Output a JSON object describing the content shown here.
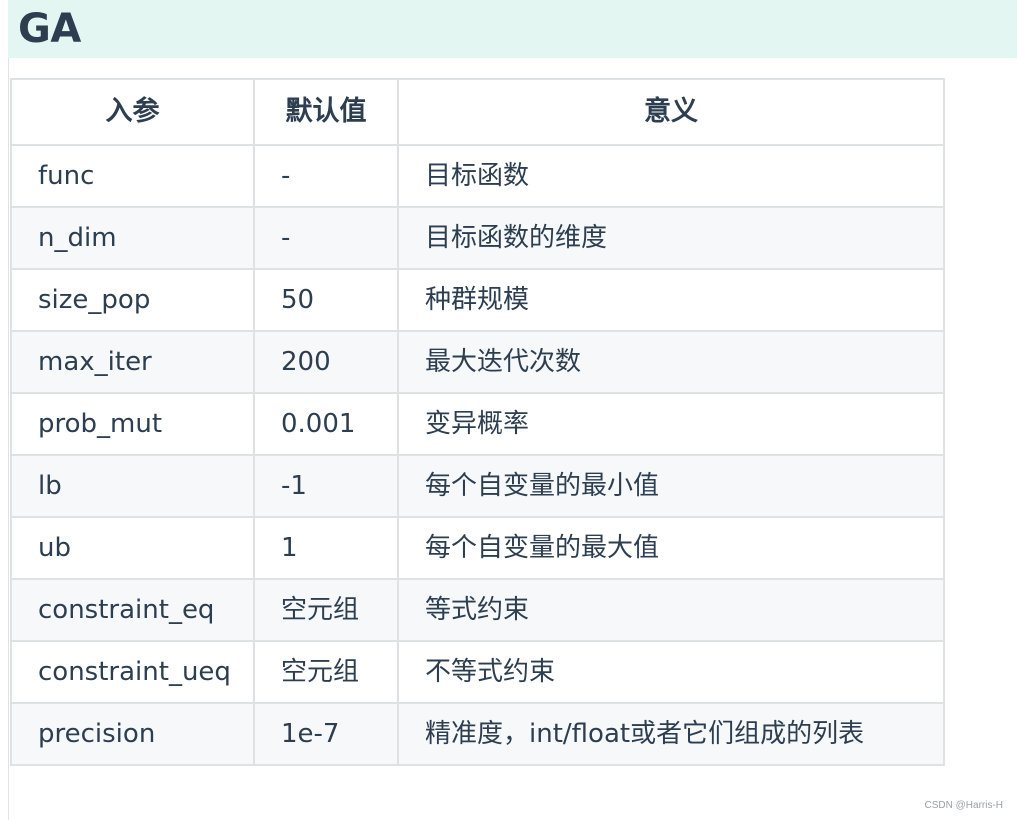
{
  "heading": "GA",
  "table": {
    "headers": [
      "入参",
      "默认值",
      "意义"
    ],
    "rows": [
      [
        "func",
        "-",
        "目标函数"
      ],
      [
        "n_dim",
        "-",
        "目标函数的维度"
      ],
      [
        "size_pop",
        "50",
        "种群规模"
      ],
      [
        "max_iter",
        "200",
        "最大迭代次数"
      ],
      [
        "prob_mut",
        "0.001",
        "变异概率"
      ],
      [
        "lb",
        "-1",
        "每个自变量的最小值"
      ],
      [
        "ub",
        "1",
        "每个自变量的最大值"
      ],
      [
        "constraint_eq",
        "空元组",
        "等式约束"
      ],
      [
        "constraint_ueq",
        "空元组",
        "不等式约束"
      ],
      [
        "precision",
        "1e-7",
        "精准度，int/float或者它们组成的列表"
      ]
    ]
  },
  "watermark": "CSDN @Harris-H"
}
